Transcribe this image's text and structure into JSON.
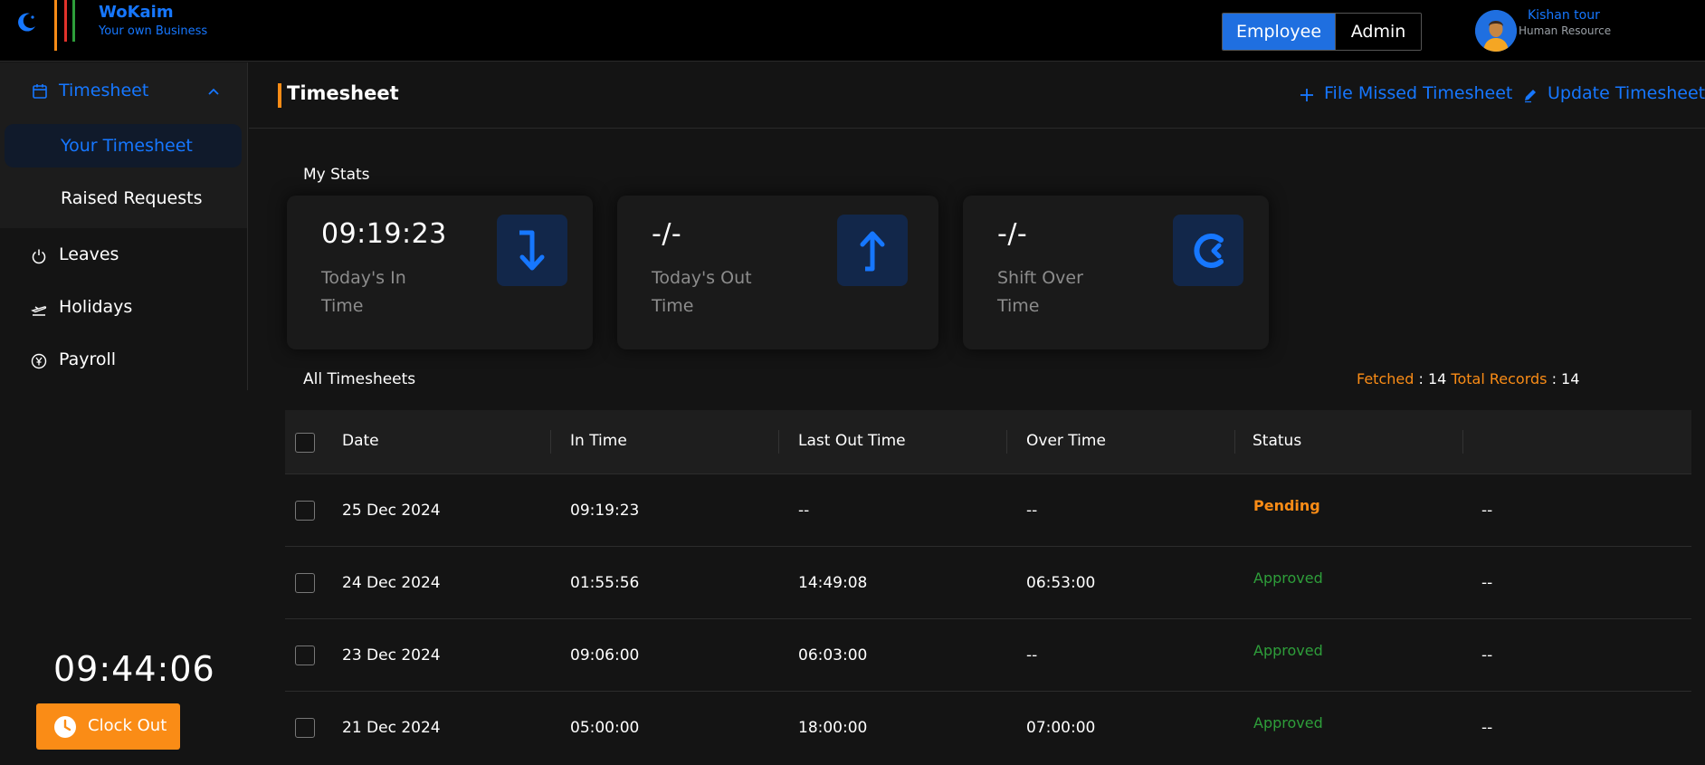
{
  "brand": {
    "name": "WoKaim",
    "tagline": "Your own Business"
  },
  "role_toggle": {
    "employee": "Employee",
    "admin": "Admin",
    "active": "employee"
  },
  "user": {
    "name": "Kishan tour",
    "role": "Human Resource"
  },
  "sidebar": {
    "group": {
      "label": "Timesheet",
      "icon": "calendar-icon",
      "items": [
        {
          "label": "Your Timesheet",
          "active": true
        },
        {
          "label": "Raised Requests",
          "active": false
        }
      ]
    },
    "items": [
      {
        "label": "Leaves",
        "icon": "power-icon"
      },
      {
        "label": "Holidays",
        "icon": "plane-icon"
      },
      {
        "label": "Payroll",
        "icon": "yen-coin-icon"
      }
    ]
  },
  "clock": {
    "time": "09:44:06",
    "button_label": "Clock Out"
  },
  "header": {
    "title": "Timesheet",
    "actions": {
      "file_missed": "File Missed Timesheet",
      "update": "Update Timesheet"
    }
  },
  "stats": {
    "title": "My Stats",
    "cards": [
      {
        "value": "09:19:23",
        "label": "Today's In Time",
        "icon": "arrow-down-icon"
      },
      {
        "value": "-/-",
        "label": "Today's Out Time",
        "icon": "arrow-up-icon"
      },
      {
        "value": "-/-",
        "label": "Shift Over Time",
        "icon": "clock-icon"
      }
    ]
  },
  "timesheets": {
    "title": "All Timesheets",
    "fetched_label": "Fetched",
    "fetched": "14",
    "total_label": "Total Records",
    "total": "14",
    "columns": [
      "Date",
      "In Time",
      "Last Out Time",
      "Over Time",
      "Status"
    ],
    "rows": [
      {
        "date": "25 Dec 2024",
        "in": "09:19:23",
        "out": "--",
        "over": "--",
        "status": "Pending",
        "extra": "--"
      },
      {
        "date": "24 Dec 2024",
        "in": "01:55:56",
        "out": "14:49:08",
        "over": "06:53:00",
        "status": "Approved",
        "extra": "--"
      },
      {
        "date": "23 Dec 2024",
        "in": "09:06:00",
        "out": "06:03:00",
        "over": "--",
        "status": "Approved",
        "extra": "--"
      },
      {
        "date": "21 Dec 2024",
        "in": "05:00:00",
        "out": "18:00:00",
        "over": "07:00:00",
        "status": "Approved",
        "extra": "--"
      }
    ]
  },
  "colors": {
    "accent": "#1677ff",
    "orange": "#fa8c16",
    "approved": "#2e9e3a",
    "background": "#141414"
  }
}
